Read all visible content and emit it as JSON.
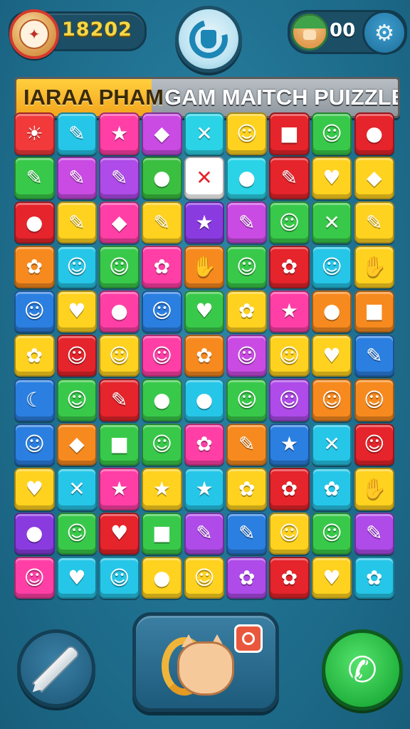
{
  "header": {
    "score": "18202",
    "lives": "00",
    "colors": {
      "score_text": "#f5d744",
      "badge_ring": "#d43a2e"
    }
  },
  "icons": {
    "badge": "emblem-icon",
    "center": "restart-icon",
    "avatar": "player-avatar-icon",
    "settings": "gear-icon",
    "pen": "pen-icon",
    "power": "creature-power-icon",
    "call": "phone-icon"
  },
  "title": {
    "left": "IARAA PHAM",
    "right": "GAM MAITCH PUIZZLE",
    "colors": {
      "left_bg": "#f6b52a",
      "right_bg": "#a3abb2"
    }
  },
  "board": {
    "rows": 11,
    "cols": 9,
    "tiles": [
      [
        "#f23a3a",
        "☀"
      ],
      [
        "#26c6e8",
        "✎"
      ],
      [
        "#ff3fa6",
        "★"
      ],
      [
        "#c94be3",
        "◆"
      ],
      [
        "#2bd3e6",
        "✕"
      ],
      [
        "#ffd21f",
        "☺"
      ],
      [
        "#e5242b",
        "■"
      ],
      [
        "#39c94a",
        "☺"
      ],
      [
        "#e5242b",
        "●"
      ],
      [
        "#39c94a",
        "✎"
      ],
      [
        "#c94be3",
        "✎"
      ],
      [
        "#ae4be9",
        "✎"
      ],
      [
        "#3bbf41",
        "●"
      ],
      [
        "#ffffff",
        "✕"
      ],
      [
        "#2bd3e6",
        "●"
      ],
      [
        "#e5242b",
        "✎"
      ],
      [
        "#ffd21f",
        "♥"
      ],
      [
        "#ffd21f",
        "◆"
      ],
      [
        "#e5242b",
        "●"
      ],
      [
        "#ffd21f",
        "✎"
      ],
      [
        "#ff3fa6",
        "◆"
      ],
      [
        "#ffd21f",
        "✎"
      ],
      [
        "#8a3be0",
        "★"
      ],
      [
        "#c94be3",
        "✎"
      ],
      [
        "#39c94a",
        "☺"
      ],
      [
        "#39c94a",
        "✕"
      ],
      [
        "#ffd21f",
        "✎"
      ],
      [
        "#f78a1f",
        "✿"
      ],
      [
        "#26c6e8",
        "☺"
      ],
      [
        "#39c94a",
        "☺"
      ],
      [
        "#ff3fa6",
        "✿"
      ],
      [
        "#f78a1f",
        "✋"
      ],
      [
        "#39c94a",
        "☺"
      ],
      [
        "#e5242b",
        "✿"
      ],
      [
        "#26c6e8",
        "☺"
      ],
      [
        "#ffd21f",
        "✋"
      ],
      [
        "#2b7fe0",
        "☺"
      ],
      [
        "#ffd21f",
        "♥"
      ],
      [
        "#ff3fa6",
        "●"
      ],
      [
        "#2b7fe0",
        "☺"
      ],
      [
        "#39c94a",
        "♥"
      ],
      [
        "#ffd21f",
        "✿"
      ],
      [
        "#ff3fa6",
        "★"
      ],
      [
        "#f78a1f",
        "●"
      ],
      [
        "#f78a1f",
        "■"
      ],
      [
        "#ffd21f",
        "✿"
      ],
      [
        "#e5242b",
        "☺"
      ],
      [
        "#ffd21f",
        "☺"
      ],
      [
        "#ff3fa6",
        "☺"
      ],
      [
        "#f78a1f",
        "✿"
      ],
      [
        "#c94be3",
        "☺"
      ],
      [
        "#ffd21f",
        "☺"
      ],
      [
        "#ffd21f",
        "♥"
      ],
      [
        "#2b7fe0",
        "✎"
      ],
      [
        "#2b7fe0",
        "☾"
      ],
      [
        "#39c94a",
        "☺"
      ],
      [
        "#e5242b",
        "✎"
      ],
      [
        "#39c94a",
        "●"
      ],
      [
        "#26c6e8",
        "●"
      ],
      [
        "#39c94a",
        "☺"
      ],
      [
        "#ae4be9",
        "☺"
      ],
      [
        "#f78a1f",
        "☺"
      ],
      [
        "#f78a1f",
        "☺"
      ],
      [
        "#2b7fe0",
        "☺"
      ],
      [
        "#f78a1f",
        "◆"
      ],
      [
        "#39c94a",
        "■"
      ],
      [
        "#39c94a",
        "☺"
      ],
      [
        "#ff3fa6",
        "✿"
      ],
      [
        "#f78a1f",
        "✎"
      ],
      [
        "#2b7fe0",
        "★"
      ],
      [
        "#26c6e8",
        "✕"
      ],
      [
        "#e5242b",
        "☺"
      ],
      [
        "#ffd21f",
        "♥"
      ],
      [
        "#26c6e8",
        "✕"
      ],
      [
        "#ff3fa6",
        "★"
      ],
      [
        "#ffd21f",
        "★"
      ],
      [
        "#26c6e8",
        "★"
      ],
      [
        "#ffd21f",
        "✿"
      ],
      [
        "#e5242b",
        "✿"
      ],
      [
        "#26c6e8",
        "✿"
      ],
      [
        "#ffd21f",
        "✋"
      ],
      [
        "#8a3be0",
        "●"
      ],
      [
        "#39c94a",
        "☺"
      ],
      [
        "#e5242b",
        "♥"
      ],
      [
        "#39c94a",
        "■"
      ],
      [
        "#ae4be9",
        "✎"
      ],
      [
        "#2b7fe0",
        "✎"
      ],
      [
        "#ffd21f",
        "☺"
      ],
      [
        "#39c94a",
        "☺"
      ],
      [
        "#ae4be9",
        "✎"
      ],
      [
        "#ff3fa6",
        "☺"
      ],
      [
        "#26c6e8",
        "♥"
      ],
      [
        "#26c6e8",
        "☺"
      ],
      [
        "#ffd21f",
        "●"
      ],
      [
        "#ffd21f",
        "☺"
      ],
      [
        "#ae4be9",
        "✿"
      ],
      [
        "#e5242b",
        "✿"
      ],
      [
        "#ffd21f",
        "♥"
      ],
      [
        "#26c6e8",
        "✿"
      ]
    ]
  }
}
